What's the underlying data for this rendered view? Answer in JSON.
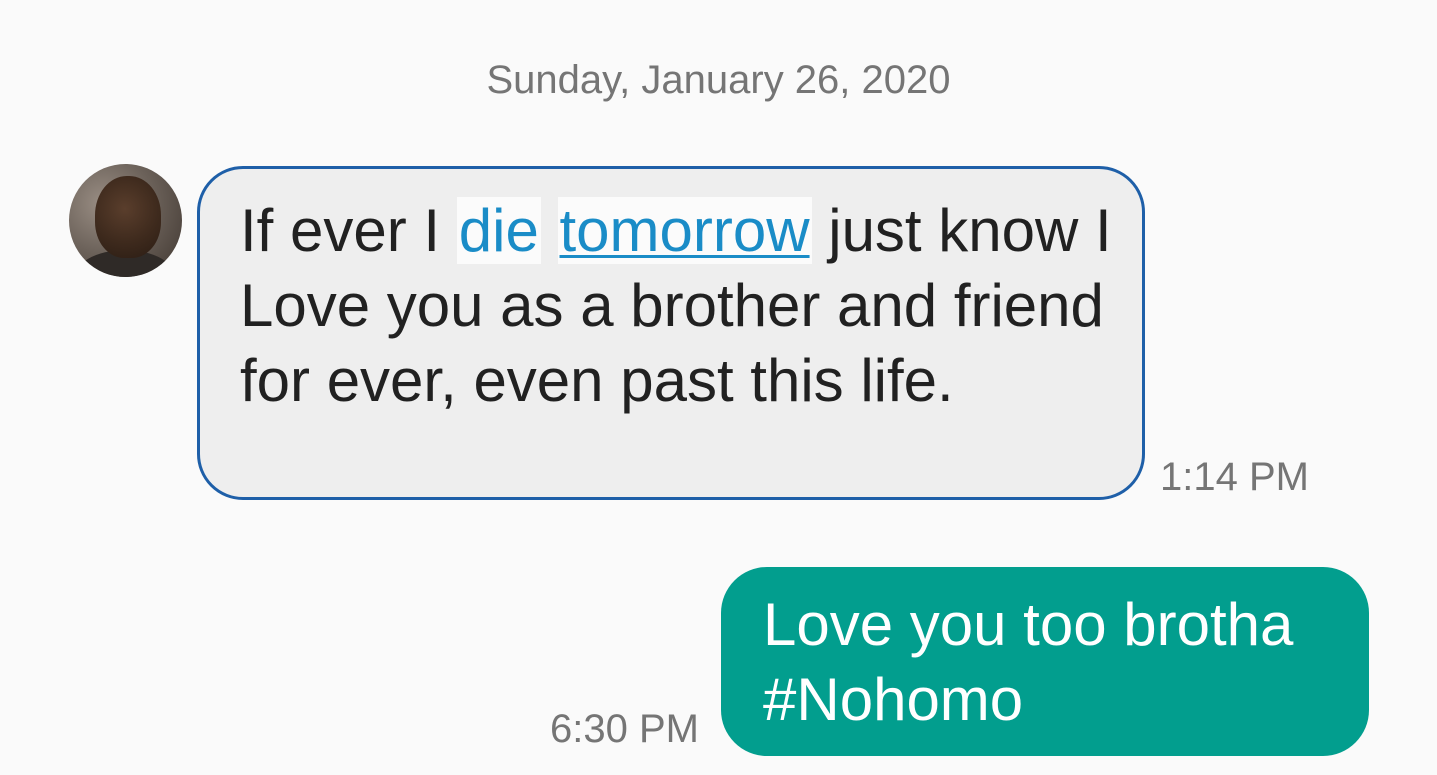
{
  "conversation": {
    "date_header": "Sunday, January 26, 2020",
    "incoming": {
      "text_before": "If ever I ",
      "link_1": "die",
      "space": " ",
      "link_2": "tomorrow",
      "text_after": " just know I Love you as a brother and friend for ever, even past this life.",
      "time": "1:14 PM"
    },
    "outgoing": {
      "line_1": "Love you too brotha",
      "line_2": "#Nohomo",
      "time": "6:30 PM"
    }
  },
  "colors": {
    "background": "#fafafa",
    "incoming_bubble": "#eeeeee",
    "incoming_border": "#1e5fa8",
    "link": "#1a8cc7",
    "outgoing_bubble": "#029e8e",
    "timestamp": "#757575"
  },
  "icons": {
    "avatar": "contact-photo"
  }
}
